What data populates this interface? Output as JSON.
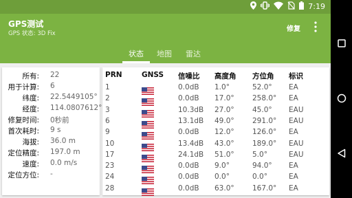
{
  "status_bar": {
    "time": "7:19"
  },
  "toolbar": {
    "title": "GPS测试",
    "subtitle": "GPS 状态:   3D Fix",
    "fix_label": "修复"
  },
  "tabs": [
    {
      "label": "状态"
    },
    {
      "label": "地图"
    },
    {
      "label": "雷达"
    }
  ],
  "status": [
    {
      "key": "所有:",
      "value": "22"
    },
    {
      "key": "用于计算:",
      "value": "6"
    },
    {
      "key": "纬度:",
      "value": "22.5449105°"
    },
    {
      "key": "经度:",
      "value": "114.0807612°"
    },
    {
      "key": "修复时间:",
      "value": "0秒前"
    },
    {
      "key": "首次耗时:",
      "value": "9 s"
    },
    {
      "key": "海拔:",
      "value": "36.0 m"
    },
    {
      "key": "定位精度:",
      "value": "197.0 m"
    },
    {
      "key": "速度:",
      "value": "0.0 m/s"
    },
    {
      "key": "定位方位:",
      "value": "-"
    }
  ],
  "sat_table": {
    "headers": [
      "PRN",
      "GNSS",
      "信噪比",
      "高度角",
      "方位角",
      "标识"
    ],
    "rows": [
      {
        "prn": "1",
        "gnss": "us-flag",
        "snr": "0.0dB",
        "elev": "1.0°",
        "azim": "52.0°",
        "flags": "EA"
      },
      {
        "prn": "2",
        "gnss": "us-flag",
        "snr": "0.0dB",
        "elev": "17.0°",
        "azim": "258.0°",
        "flags": "EA"
      },
      {
        "prn": "3",
        "gnss": "us-flag",
        "snr": "10.3dB",
        "elev": "27.0°",
        "azim": "45.0°",
        "flags": "EAU"
      },
      {
        "prn": "6",
        "gnss": "us-flag",
        "snr": "13.1dB",
        "elev": "49.0°",
        "azim": "291.0°",
        "flags": "EAU"
      },
      {
        "prn": "9",
        "gnss": "us-flag",
        "snr": "0.0dB",
        "elev": "12.0°",
        "azim": "126.0°",
        "flags": "EA"
      },
      {
        "prn": "10",
        "gnss": "us-flag",
        "snr": "13.4dB",
        "elev": "43.0°",
        "azim": "189.0°",
        "flags": "EAU"
      },
      {
        "prn": "17",
        "gnss": "us-flag",
        "snr": "24.1dB",
        "elev": "51.0°",
        "azim": "5.0°",
        "flags": "EAU"
      },
      {
        "prn": "23",
        "gnss": "us-flag",
        "snr": "0.0dB",
        "elev": "9.0°",
        "azim": "94.0°",
        "flags": "EA"
      },
      {
        "prn": "24",
        "gnss": "us-flag",
        "snr": "0.0dB",
        "elev": "0.0°",
        "azim": "0.0°",
        "flags": "EA"
      },
      {
        "prn": "28",
        "gnss": "us-flag",
        "snr": "0.0dB",
        "elev": "63.0°",
        "azim": "167.0°",
        "flags": "EA"
      }
    ]
  },
  "colors": {
    "toolbar": "#7cb342",
    "status_bar": "#6e9e3a",
    "accent_white": "#ffffff"
  },
  "icons": [
    "location-icon",
    "vibrate-icon",
    "wifi-icon",
    "no-sim-icon",
    "battery-icon",
    "more-vert-icon",
    "nav-recents-icon",
    "nav-home-icon",
    "nav-back-icon"
  ]
}
